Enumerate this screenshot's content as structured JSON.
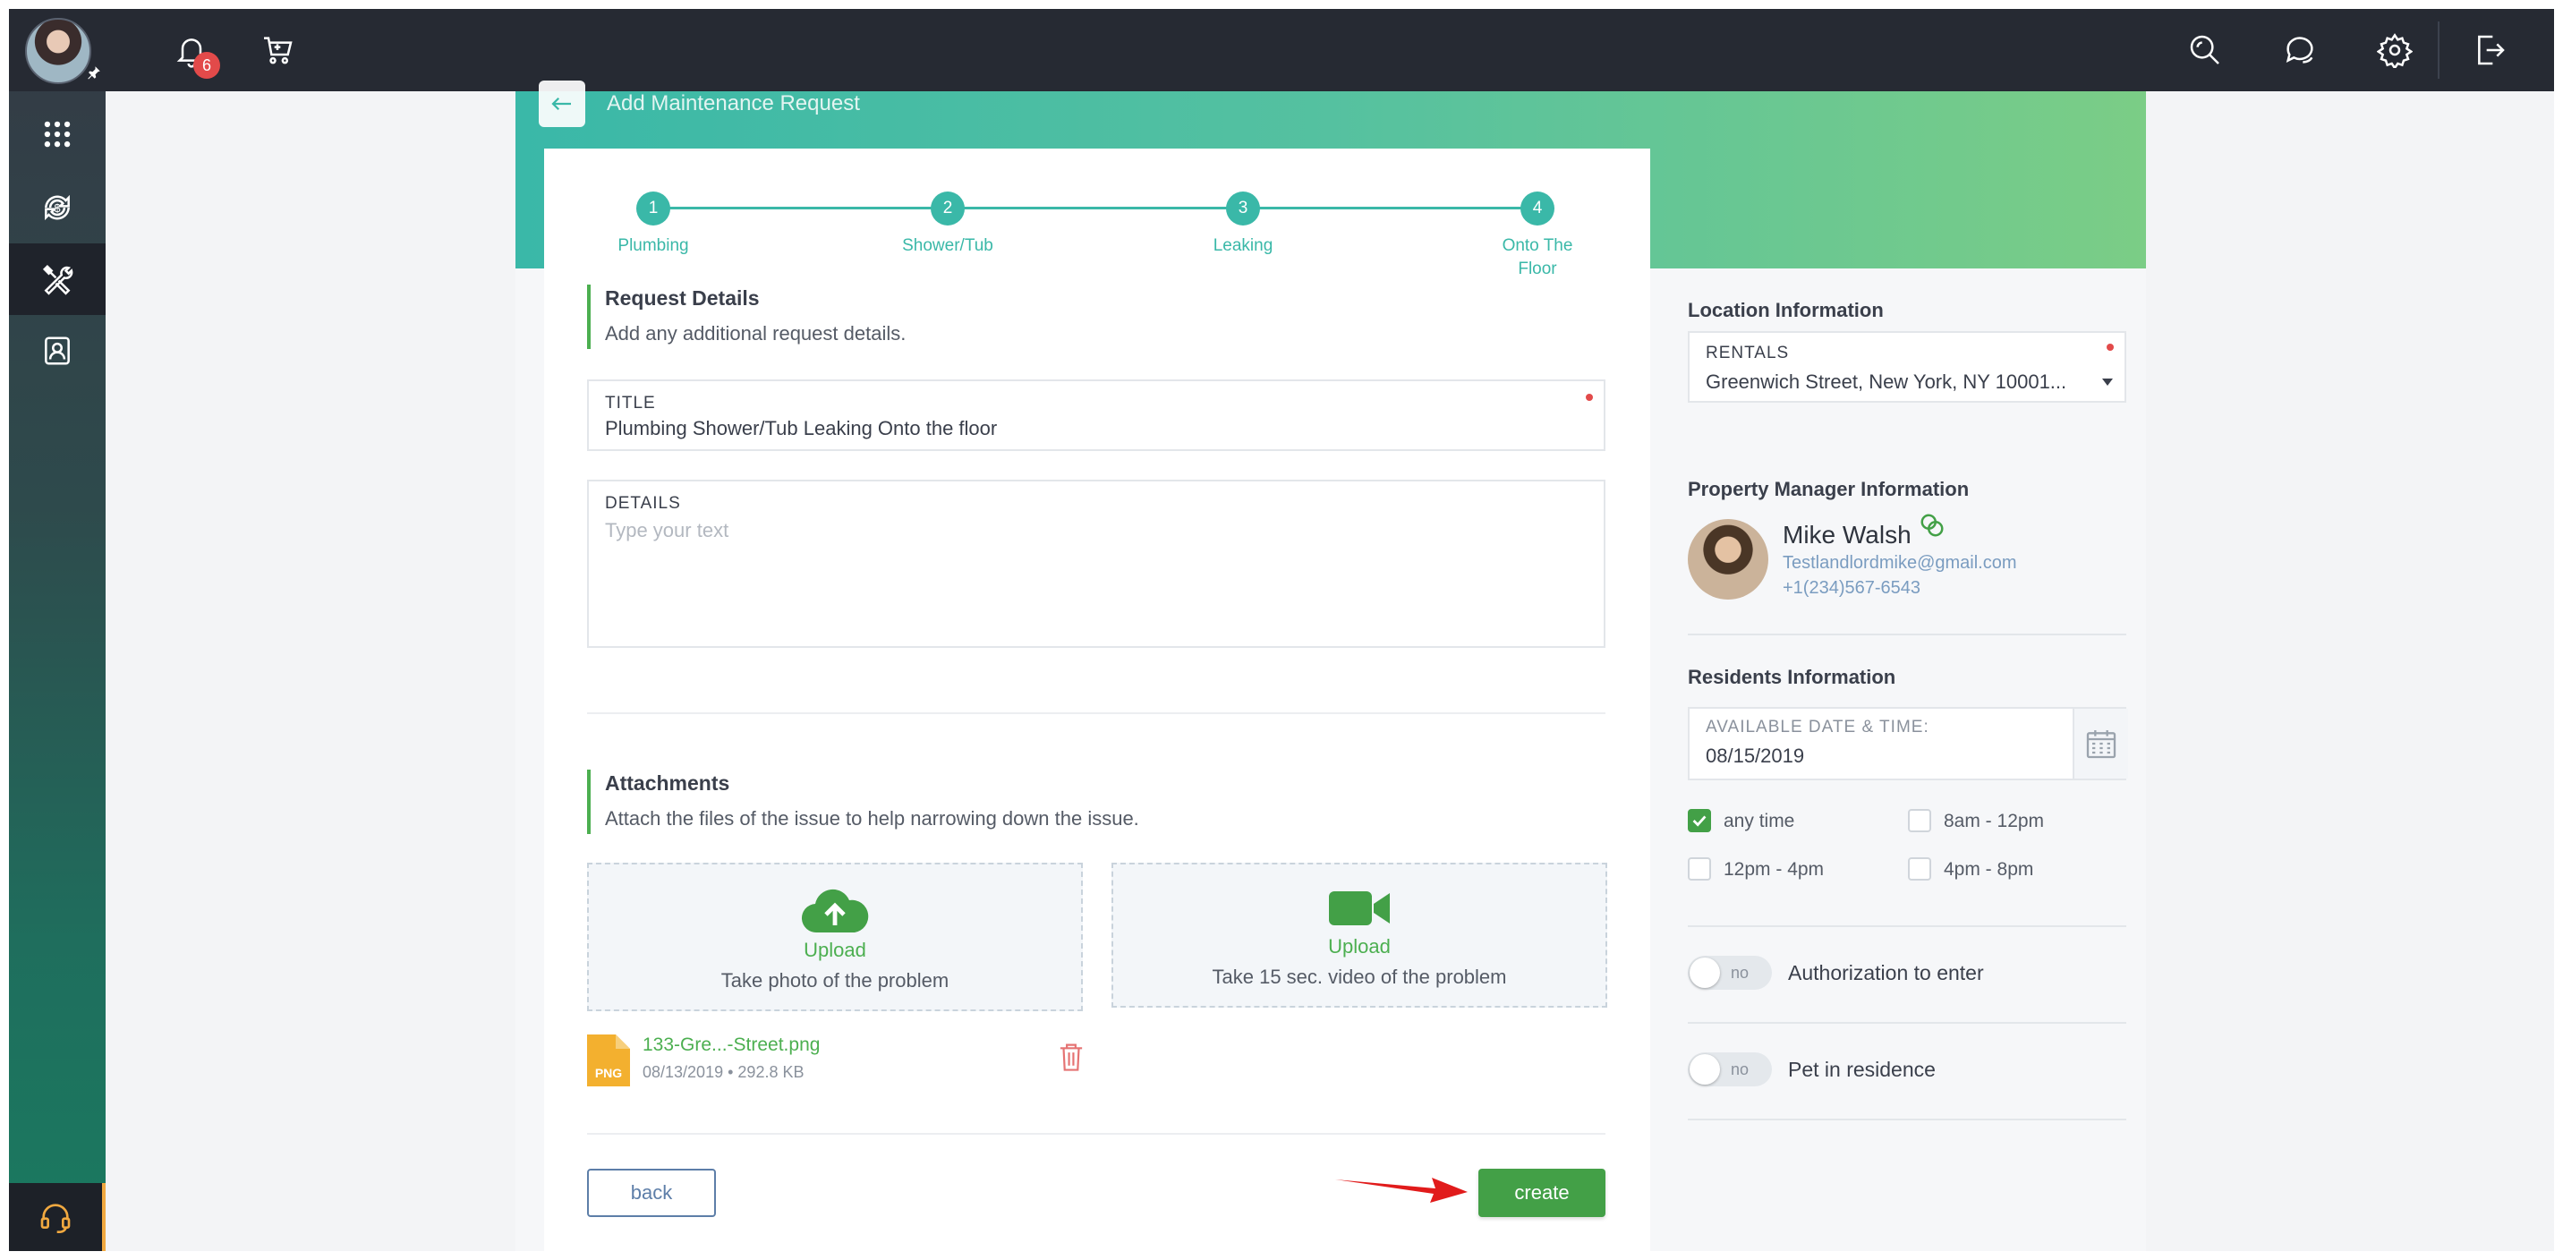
{
  "topbar": {
    "notification_count": "6"
  },
  "page": {
    "title": "Add Maintenance Request"
  },
  "stepper": [
    {
      "num": "1",
      "label": "Plumbing"
    },
    {
      "num": "2",
      "label": "Shower/Tub"
    },
    {
      "num": "3",
      "label": "Leaking"
    },
    {
      "num": "4",
      "label": "Onto The Floor"
    }
  ],
  "request_details": {
    "title": "Request Details",
    "subtitle": "Add any additional request details.",
    "title_field": {
      "label": "TITLE",
      "value": "Plumbing Shower/Tub Leaking Onto the floor"
    },
    "details_field": {
      "label": "DETAILS",
      "placeholder": "Type your text"
    }
  },
  "attachments": {
    "title": "Attachments",
    "subtitle": "Attach the files of the issue to help narrowing down the issue.",
    "photo": {
      "title": "Upload",
      "sub": "Take photo of the problem"
    },
    "video": {
      "title": "Upload",
      "sub": "Take 15 sec. video of the problem"
    },
    "file": {
      "type": "PNG",
      "name": "133-Gre...-Street.png",
      "date": "08/13/2019",
      "size": "292.8 KB"
    }
  },
  "buttons": {
    "back": "back",
    "create": "create"
  },
  "location": {
    "title": "Location Information",
    "label": "RENTALS",
    "value": "Greenwich Street, New York, NY 10001..."
  },
  "property_manager": {
    "title": "Property Manager Information",
    "name": "Mike Walsh",
    "email": "Testlandlordmike@gmail.com",
    "phone": "+1(234)567-6543"
  },
  "residents": {
    "title": "Residents Information",
    "date_label": "AVAILABLE DATE & TIME:",
    "date_value": "08/15/2019",
    "time_slots": [
      {
        "label": "any time",
        "checked": true
      },
      {
        "label": "8am - 12pm",
        "checked": false
      },
      {
        "label": "12pm - 4pm",
        "checked": false
      },
      {
        "label": "4pm - 8pm",
        "checked": false
      }
    ]
  },
  "toggles": [
    {
      "state": "no",
      "label": "Authorization to enter"
    },
    {
      "state": "no",
      "label": "Pet in residence"
    }
  ],
  "colors": {
    "accent_teal": "#3ab8a8",
    "accent_green": "#43a047",
    "sidebar_dark": "#262a33"
  }
}
